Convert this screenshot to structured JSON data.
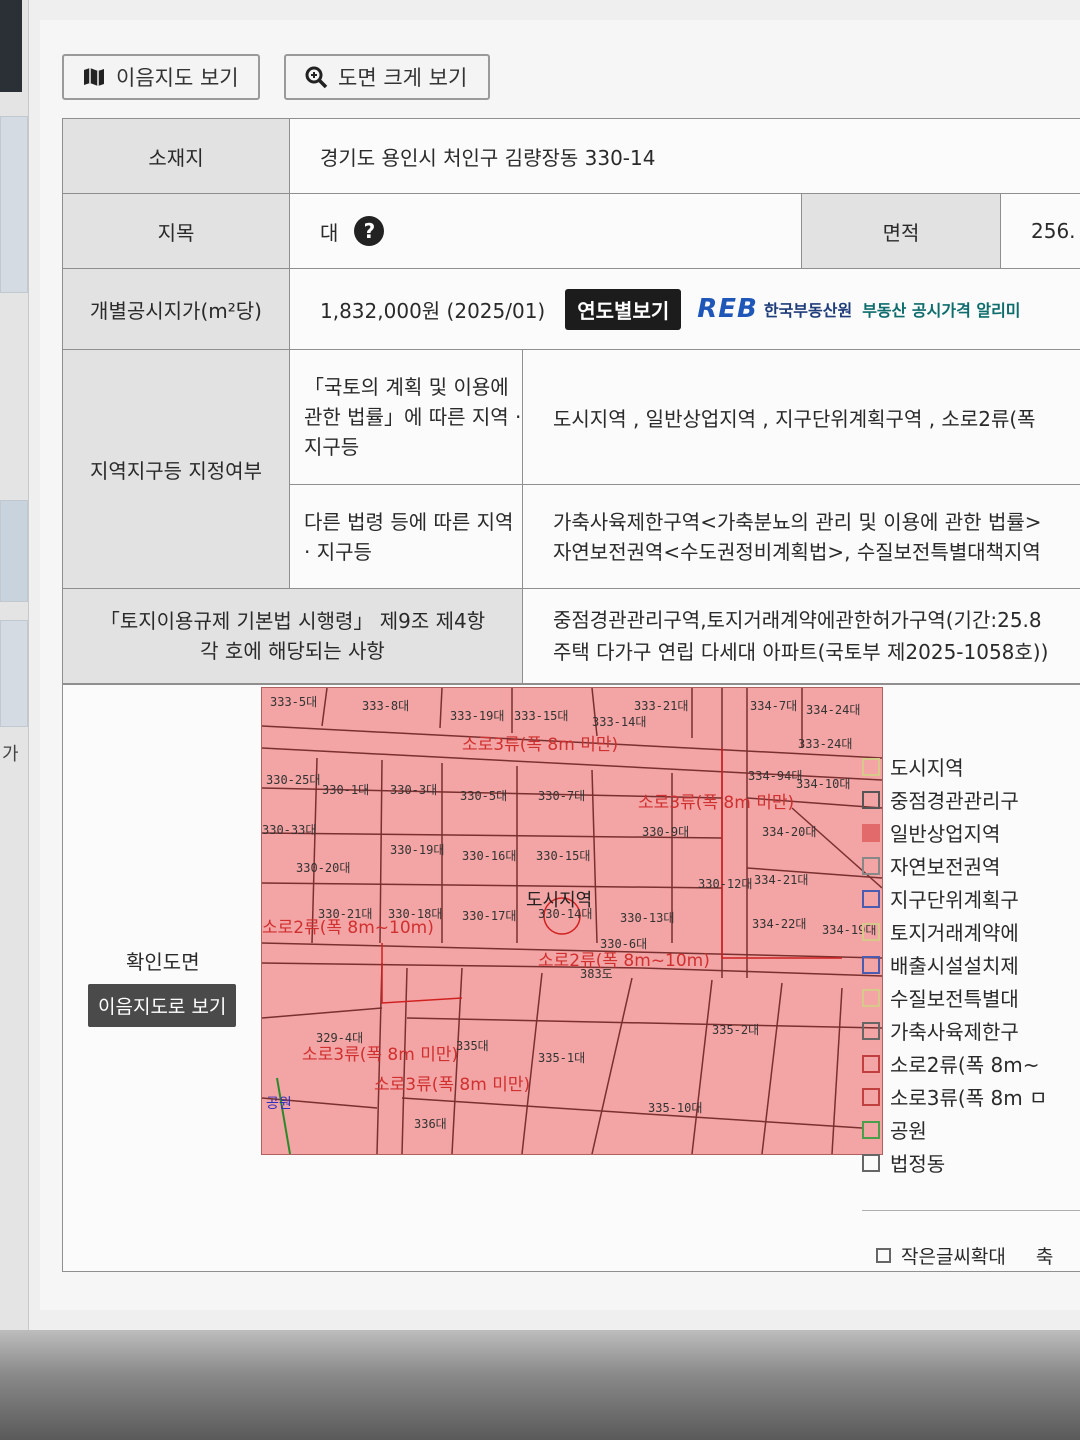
{
  "toolbar": {
    "neighbor_map_button": "이음지도 보기",
    "enlarge_button": "도면 크게 보기"
  },
  "side": {
    "fragment_char": "가"
  },
  "info": {
    "location_label": "소재지",
    "location_value": "경기도 용인시 처인구 김량장동 330-14",
    "land_category_label": "지목",
    "land_category_value": "대",
    "help_badge": "?",
    "area_label": "면적",
    "area_value": "256.",
    "price_label": "개별공시지가(m²당)",
    "price_value": "1,832,000원 (2025/01)",
    "year_button": "연도별보기",
    "reb_logo": "REB",
    "reb_name": "한국부동산원",
    "reb_service": "부동산 공시가격 알리미",
    "zoning_label": "지역지구등 지정여부",
    "national_law_label": "「국토의 계획 및 이용에 관한 법률」에 따른 지역 · 지구등",
    "national_law_value": "도시지역 , 일반상업지역 , 지구단위계획구역 , 소로2류(폭",
    "other_law_label": "다른 법령 등에 따른 지역 · 지구등",
    "other_law_value_1": "가축사육제한구역<가축분뇨의 관리 및 이용에 관한 법률>",
    "other_law_value_2": "자연보전권역<수도권정비계획법>, 수질보전특별대책지역",
    "decree_label": "「토지이용규제 기본법 시행령」 제9조 제4항 각 호에 해당되는 사항",
    "decree_value_1": "중점경관관리구역,토지거래계약에관한허가구역(기간:25.8",
    "decree_value_2": "주택 다가구 연립 다세대 아파트(국토부 제2025-1058호))"
  },
  "confirm": {
    "label": "확인도면",
    "button": "이음지도로 보기"
  },
  "map": {
    "parcels": [
      "333-5대",
      "333-8대",
      "333-19대",
      "333-15대",
      "333-14대",
      "333-21대",
      "334-7대",
      "334-24대",
      "330-25대",
      "330-1대",
      "330-3대",
      "330-5대",
      "330-7대",
      "330-9대",
      "334-94대",
      "334-10대",
      "334-20대",
      "330-33대",
      "330-19대",
      "330-16대",
      "330-15대",
      "330-20대",
      "330-21대",
      "330-18대",
      "330-17대",
      "330-14대",
      "330-13대",
      "330-12대",
      "334-21대",
      "334-22대",
      "334-19대",
      "329-4대",
      "335대",
      "335-1대",
      "335-2대",
      "335-10대",
      "336대",
      "383도",
      "333-24대",
      "330-6대"
    ],
    "road_labels": [
      "소로3류(폭 8m 미만)",
      "소로3류(폭 8m 미만)",
      "소로2류(폭 8m~10m)",
      "소로2류(폭 8m~10m)",
      "소로3류(폭 8m 미만)",
      "소로3류(폭 8m 미만)"
    ],
    "zone_label": "도시지역",
    "park_label": "공원"
  },
  "legend": {
    "items": [
      {
        "label": "도시지역",
        "color": "#d8c98a"
      },
      {
        "label": "중점경관관리구",
        "color": "#555555"
      },
      {
        "label": "일반상업지역",
        "color": "#e26a6a"
      },
      {
        "label": "자연보전권역",
        "color": "#888888"
      },
      {
        "label": "지구단위계획구",
        "color": "#4a5bb0"
      },
      {
        "label": "토지거래계약에",
        "color": "#d8c98a"
      },
      {
        "label": "배출시설설치제",
        "color": "#4a5bb0"
      },
      {
        "label": "수질보전특별대",
        "color": "#d8c98a"
      },
      {
        "label": "가축사육제한구",
        "color": "#666666"
      },
      {
        "label": "소로2류(폭 8m~",
        "color": "#c04040"
      },
      {
        "label": "소로3류(폭 8m ㅁ",
        "color": "#c04040"
      },
      {
        "label": "공원",
        "color": "#4aa04a"
      },
      {
        "label": "법정동",
        "color": "#666666"
      }
    ],
    "small_font_label": "작은글씨확대",
    "cut_label": "축"
  }
}
